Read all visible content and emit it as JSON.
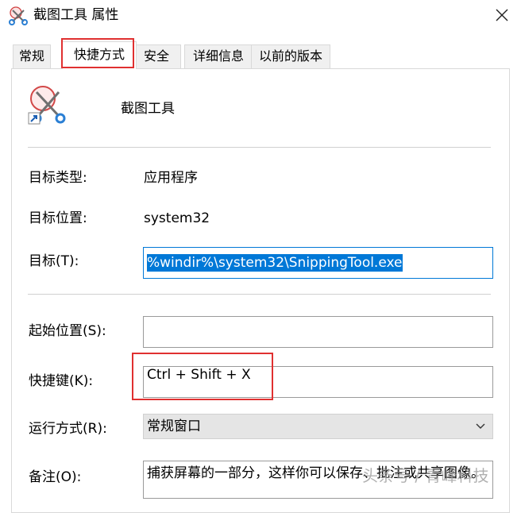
{
  "window": {
    "title": "截图工具 属性",
    "close_glyph": "✕"
  },
  "tabs": [
    {
      "label": "常规",
      "active": false
    },
    {
      "label": "快捷方式",
      "active": true
    },
    {
      "label": "安全",
      "active": false
    },
    {
      "label": "详细信息",
      "active": false
    },
    {
      "label": "以前的版本",
      "active": false
    }
  ],
  "shortcut": {
    "app_name": "截图工具",
    "app_icon": "snipping-tool-scissors-icon",
    "target_type_label": "目标类型:",
    "target_type_value": "应用程序",
    "target_location_label": "目标位置:",
    "target_location_value": "system32",
    "target_label": "目标(T):",
    "target_value": "%windir%\\system32\\SnippingTool.exe",
    "start_in_label": "起始位置(S):",
    "start_in_value": "",
    "hotkey_label": "快捷键(K):",
    "hotkey_value": "Ctrl + Shift + X",
    "run_label": "运行方式(R):",
    "run_value": "常规窗口",
    "comment_label": "备注(O):",
    "comment_value": "捕获屏幕的一部分，这样你可以保存、批注或共享图像。"
  },
  "watermark": "头条号 / 青峰科技",
  "colors": {
    "highlight_red": "#e03030",
    "selection_blue": "#0078d7"
  }
}
